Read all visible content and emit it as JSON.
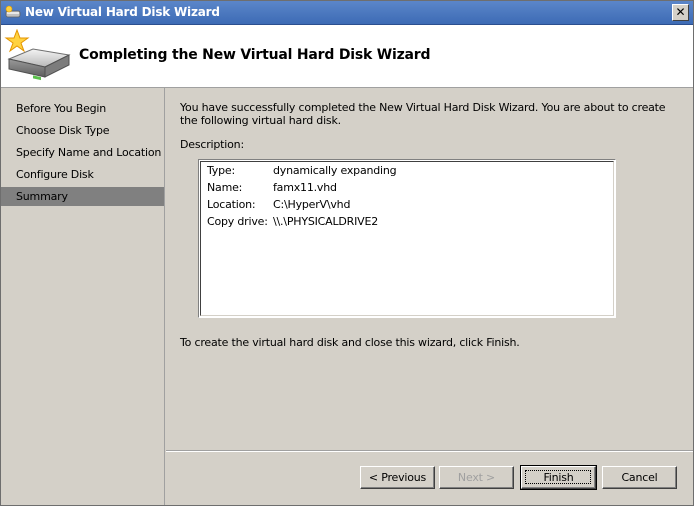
{
  "window": {
    "title": "New Virtual Hard Disk Wizard",
    "close_glyph": "✕"
  },
  "header": {
    "title": "Completing the New Virtual Hard Disk Wizard",
    "icon": "disk-wizard-icon"
  },
  "sidebar": {
    "items": [
      {
        "label": "Before You Begin",
        "selected": false
      },
      {
        "label": "Choose Disk Type",
        "selected": false
      },
      {
        "label": "Specify Name and Location",
        "selected": false
      },
      {
        "label": "Configure Disk",
        "selected": false
      },
      {
        "label": "Summary",
        "selected": true
      }
    ]
  },
  "main": {
    "intro": "You have successfully completed the New Virtual Hard Disk Wizard. You are about to create the following virtual hard disk.",
    "description_label": "Description:",
    "description_rows": [
      {
        "key": "Type:",
        "value": "dynamically expanding"
      },
      {
        "key": "Name:",
        "value": "famx11.vhd"
      },
      {
        "key": "Location:",
        "value": "C:\\HyperV\\vhd"
      },
      {
        "key": "Copy drive:",
        "value": "\\\\.\\PHYSICALDRIVE2"
      }
    ],
    "finish_note": "To create the virtual hard disk and close this wizard, click Finish."
  },
  "buttons": {
    "previous": "< Previous",
    "next": "Next >",
    "finish": "Finish",
    "cancel": "Cancel"
  },
  "colors": {
    "title_bar": "#4a78c0",
    "selected_item": "#808080",
    "face": "#d4d0c8"
  }
}
